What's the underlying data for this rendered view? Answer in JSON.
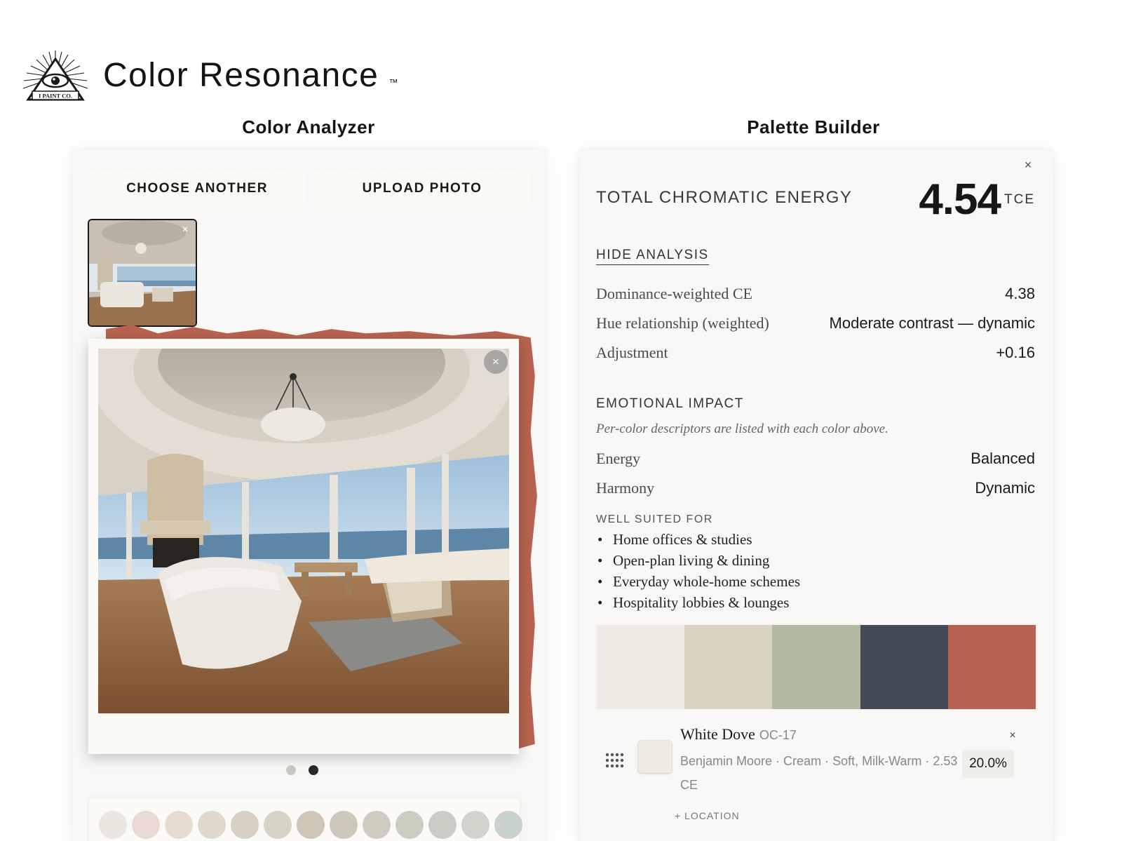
{
  "header": {
    "logo_text": "I PAINT CO.",
    "title": "Color Resonance",
    "trademark": "™"
  },
  "sections": {
    "analyzer_title": "Color Analyzer",
    "builder_title": "Palette Builder"
  },
  "analyzer": {
    "choose_label": "CHOOSE ANOTHER",
    "upload_label": "UPLOAD PHOTO",
    "close_glyph": "×",
    "carousel": {
      "count": 2,
      "active": 2
    },
    "swatch_colors": [
      "#ece6e0",
      "#ead9d4",
      "#e5dccf",
      "#e0d8cb",
      "#d8d1c3",
      "#d6d3c6",
      "#cfc5b6",
      "#ccc7b9",
      "#d0cbbf",
      "#cdcdc2",
      "#cbcdc4",
      "#d2d4cb",
      "#c8d1cc"
    ]
  },
  "builder": {
    "close_glyph": "×",
    "tce": {
      "label": "TOTAL CHROMATIC ENERGY",
      "value": "4.54",
      "unit": "TCE"
    },
    "hide_analysis": "HIDE ANALYSIS",
    "metrics": [
      {
        "label": "Dominance-weighted CE",
        "value": "4.38"
      },
      {
        "label": "Hue relationship (weighted)",
        "value": "Moderate contrast — dynamic"
      },
      {
        "label": "Adjustment",
        "value": "+0.16"
      }
    ],
    "emotional": {
      "heading": "EMOTIONAL IMPACT",
      "note": "Per-color descriptors are listed with each color above.",
      "rows": [
        {
          "label": "Energy",
          "value": "Balanced"
        },
        {
          "label": "Harmony",
          "value": "Dynamic"
        }
      ]
    },
    "suited": {
      "heading": "WELL SUITED FOR",
      "items": [
        "Home offices & studies",
        "Open-plan living & dining",
        "Everyday whole-home schemes",
        "Hospitality lobbies & lounges"
      ]
    },
    "palette": [
      "#eeebe5",
      "#dbd4c4",
      "#b2b9a2",
      "#444a56",
      "#b76352"
    ],
    "entry": {
      "name": "White Dove",
      "code": "OC-17",
      "meta": "Benjamin Moore · Cream · Soft, Milk-Warm · 2.53 CE",
      "percent": "20.0%",
      "location": "+ LOCATION",
      "swatch": "#eeebe2",
      "close_glyph": "×"
    }
  }
}
